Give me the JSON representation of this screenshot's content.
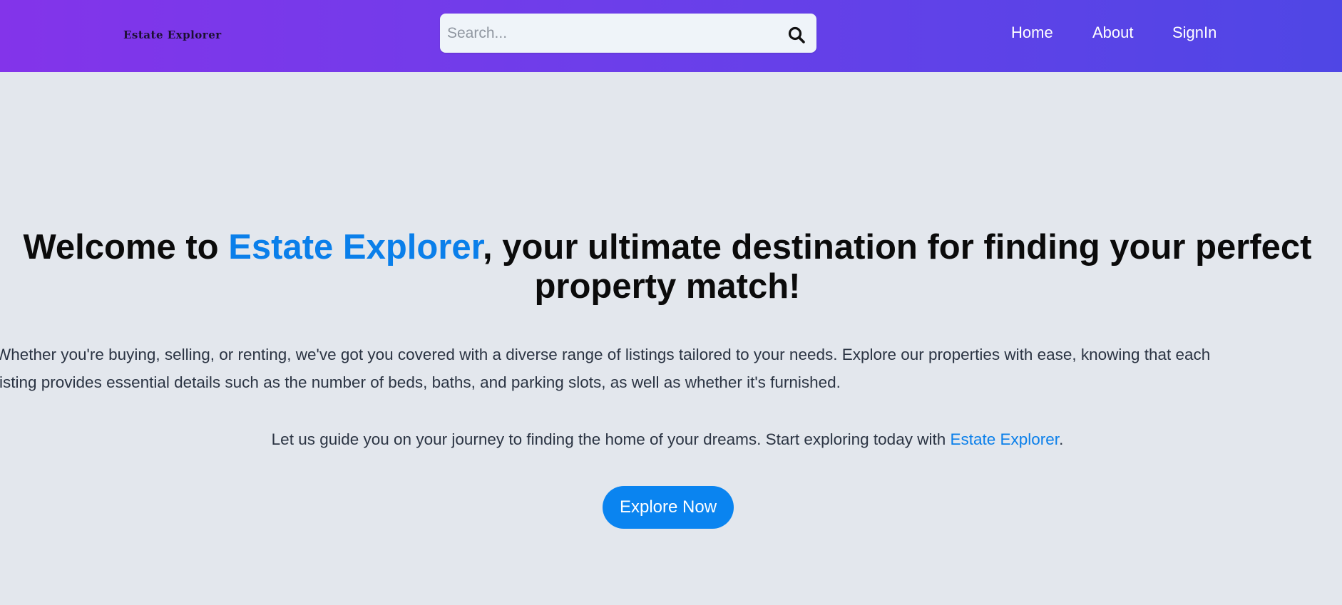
{
  "navbar": {
    "logo": "Estate Explorer",
    "search": {
      "placeholder": "Search...",
      "value": "",
      "icon": "search-icon"
    },
    "links": {
      "home": "Home",
      "about": "About",
      "signin": "SignIn"
    },
    "gradient_start": "#8334ea",
    "gradient_end": "#4f46e5"
  },
  "hero": {
    "title_prefix": "Welcome to ",
    "title_brand": "Estate Explorer",
    "title_suffix": ", your ultimate destination for finding your perfect property match!",
    "paragraph_line1": "Whether you're buying, selling, or renting, we've got you covered with a diverse range of listings tailored to your needs. Explore our properties with ease, knowing that each",
    "paragraph_line2": "listing provides essential details such as the number of beds, baths, and parking slots, as well as whether it's furnished.",
    "guide_prefix": "Let us guide you on your journey to finding the home of your dreams. Start exploring today with ",
    "guide_brand": "Estate Explorer",
    "guide_suffix": ".",
    "button_label": "Explore Now",
    "accent_color": "#0a7fea"
  }
}
